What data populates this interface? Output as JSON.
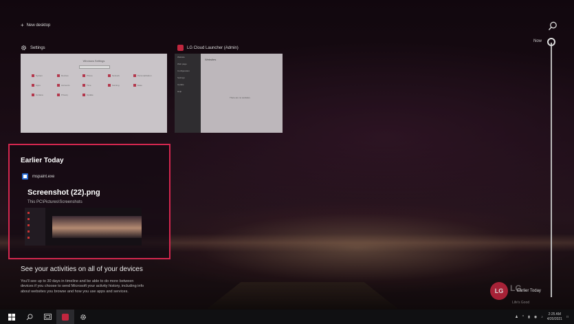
{
  "new_desktop": {
    "label": "New desktop"
  },
  "timeline": {
    "now_label": "Now",
    "earlier_label": "Earlier Today"
  },
  "windows": [
    {
      "title": "Settings",
      "thumb_title": "Windows Settings",
      "tiles": [
        "System",
        "Devices",
        "Phone",
        "Network",
        "Personalization",
        "Apps",
        "Accounts",
        "Time",
        "Gaming",
        "Ease",
        "Cortana",
        "Privacy",
        "Update"
      ]
    },
    {
      "title": "LG Cloud Launcher (Admin)",
      "thumb_title": "Websites",
      "sidebar": [
        "Website",
        "Web page",
        "Configuration",
        "Settings",
        "Update",
        "Help"
      ],
      "message": "There are no websites."
    }
  ],
  "earlier": {
    "title": "Earlier Today",
    "app_name": "mspaint.exe",
    "file_title": "Screenshot (22).png",
    "file_path": "This PC\\Pictures\\Screenshots"
  },
  "activities": {
    "title": "See your activities on all of your devices",
    "body": "You'll see up to 30 days in timeline and be able to do more between devices if you choose to send Microsoft your activity history, including info about websites you browse and how you use apps and services."
  },
  "branding": {
    "logo": "LG",
    "tagline": "Life's Good"
  },
  "taskbar": {
    "time": "2:25 AM",
    "date": "4/20/2021"
  },
  "colors": {
    "accent": "#d4274f",
    "lg_red": "#c0263e"
  }
}
